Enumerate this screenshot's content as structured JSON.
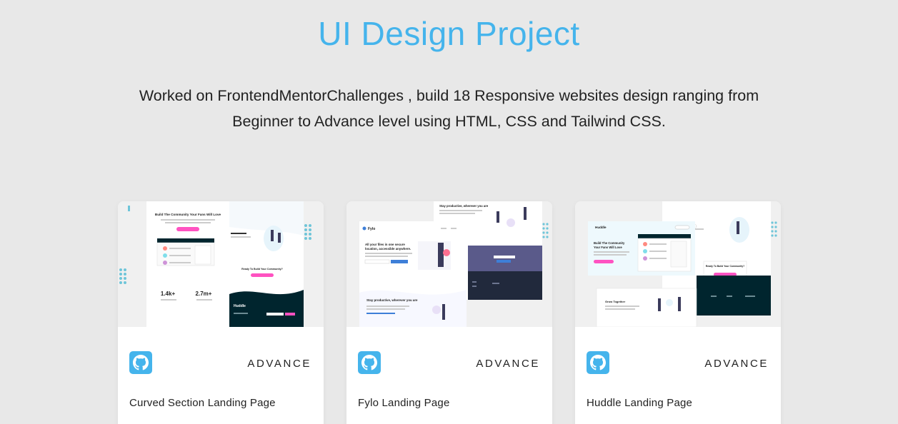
{
  "section": {
    "title": "UI Design Project",
    "description": "Worked on FrontendMentorChallenges , build 18 Responsive websites design ranging from Beginner to Advance level using HTML, CSS and Tailwind CSS."
  },
  "colors": {
    "accent": "#45b4ec",
    "background": "#e8e8e8",
    "card": "#ffffff"
  },
  "cards": [
    {
      "name": "Curved Section Landing Page",
      "level": "ADVANCE",
      "icon": "github-icon",
      "preview": {
        "headline": "Build The Community Your Fans Will Love",
        "stat_1": "1.4k+",
        "stat_2": "2.7m+",
        "cta": "Ready To Build Your Community?",
        "brand": "Huddle"
      }
    },
    {
      "name": "Fylo Landing Page",
      "level": "ADVANCE",
      "icon": "github-icon",
      "preview": {
        "brand": "Fylo",
        "headline": "All your files in one secure location, accessible anywhere.",
        "subhead": "Stay productive, wherever you are"
      }
    },
    {
      "name": "Huddle Landing Page",
      "level": "ADVANCE",
      "icon": "github-icon",
      "preview": {
        "brand": "Huddle",
        "headline": "Build The Community Your Fans Will Love",
        "subhead": "Grow Together",
        "cta": "Ready To Build Your Community?"
      }
    }
  ]
}
